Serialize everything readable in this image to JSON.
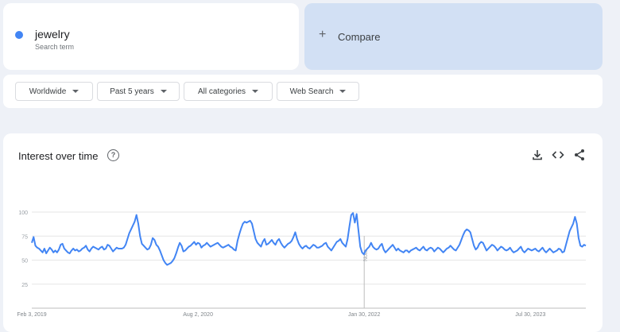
{
  "search_term": {
    "name": "jewelry",
    "sublabel": "Search term",
    "color": "#4285f4"
  },
  "compare": {
    "label": "Compare",
    "icon": "plus-icon"
  },
  "filters": [
    {
      "label": "Worldwide"
    },
    {
      "label": "Past 5 years"
    },
    {
      "label": "All categories"
    },
    {
      "label": "Web Search"
    }
  ],
  "chart_card": {
    "title": "Interest over time",
    "icons": [
      "help-icon",
      "download-icon",
      "embed-icon",
      "share-icon"
    ]
  },
  "chart_data": {
    "type": "line",
    "title": "Interest over time",
    "xlabel": "",
    "ylabel": "",
    "ylim": [
      0,
      100
    ],
    "yticks": [
      25,
      50,
      75,
      100
    ],
    "xticks": [
      "Feb 3, 2019",
      "Aug 2, 2020",
      "Jan 30, 2022",
      "Jul 30, 2023"
    ],
    "x_range": [
      "2019-02-03",
      "2024-01-28"
    ],
    "grid": true,
    "line_color": "#4285f4",
    "annotation": {
      "label": "Note",
      "date": "2022-01-30"
    },
    "series": [
      {
        "values": [
          68,
          74,
          65,
          63,
          62,
          60,
          58,
          62,
          57,
          60,
          63,
          61,
          58,
          60,
          58,
          61,
          66,
          67,
          62,
          60,
          58,
          57,
          60,
          62,
          60,
          61,
          59,
          60,
          62,
          63,
          65,
          61,
          59,
          62,
          64,
          63,
          62,
          61,
          63,
          64,
          61,
          62,
          66,
          65,
          62,
          59,
          61,
          63,
          62,
          62,
          62,
          63,
          66,
          72,
          78,
          82,
          86,
          90,
          97,
          88,
          75,
          67,
          65,
          63,
          61,
          62,
          66,
          73,
          71,
          66,
          64,
          60,
          55,
          50,
          47,
          45,
          46,
          47,
          49,
          52,
          57,
          63,
          68,
          65,
          59,
          60,
          62,
          64,
          65,
          67,
          69,
          66,
          68,
          67,
          63,
          65,
          66,
          68,
          66,
          64,
          65,
          66,
          67,
          68,
          66,
          64,
          63,
          64,
          65,
          66,
          64,
          63,
          61,
          60,
          70,
          77,
          83,
          88,
          90,
          89,
          90,
          91,
          88,
          80,
          72,
          68,
          66,
          64,
          69,
          72,
          66,
          67,
          69,
          71,
          68,
          66,
          70,
          72,
          68,
          65,
          63,
          65,
          67,
          68,
          70,
          74,
          79,
          72,
          67,
          64,
          62,
          64,
          65,
          63,
          62,
          64,
          66,
          65,
          63,
          63,
          64,
          65,
          67,
          68,
          64,
          62,
          60,
          63,
          66,
          69,
          70,
          72,
          68,
          66,
          64,
          72,
          85,
          97,
          99,
          89,
          98,
          81,
          64,
          58,
          56,
          60,
          62,
          64,
          68,
          64,
          62,
          61,
          62,
          65,
          67,
          61,
          58,
          60,
          62,
          64,
          66,
          63,
          60,
          62,
          60,
          59,
          58,
          60,
          60,
          58,
          60,
          61,
          62,
          63,
          61,
          60,
          62,
          64,
          61,
          60,
          62,
          63,
          62,
          59,
          61,
          63,
          62,
          60,
          58,
          60,
          62,
          63,
          65,
          63,
          61,
          60,
          63,
          66,
          71,
          76,
          80,
          82,
          81,
          79,
          72,
          65,
          61,
          63,
          67,
          69,
          68,
          64,
          60,
          62,
          64,
          66,
          65,
          63,
          60,
          62,
          64,
          63,
          61,
          60,
          61,
          63,
          60,
          58,
          59,
          60,
          62,
          64,
          60,
          58,
          60,
          62,
          61,
          60,
          61,
          62,
          60,
          59,
          61,
          63,
          60,
          58,
          60,
          62,
          60,
          58,
          59,
          60,
          62,
          61,
          58,
          59,
          66,
          73,
          80,
          84,
          88,
          95,
          88,
          73,
          65,
          64,
          66,
          65
        ]
      }
    ]
  }
}
